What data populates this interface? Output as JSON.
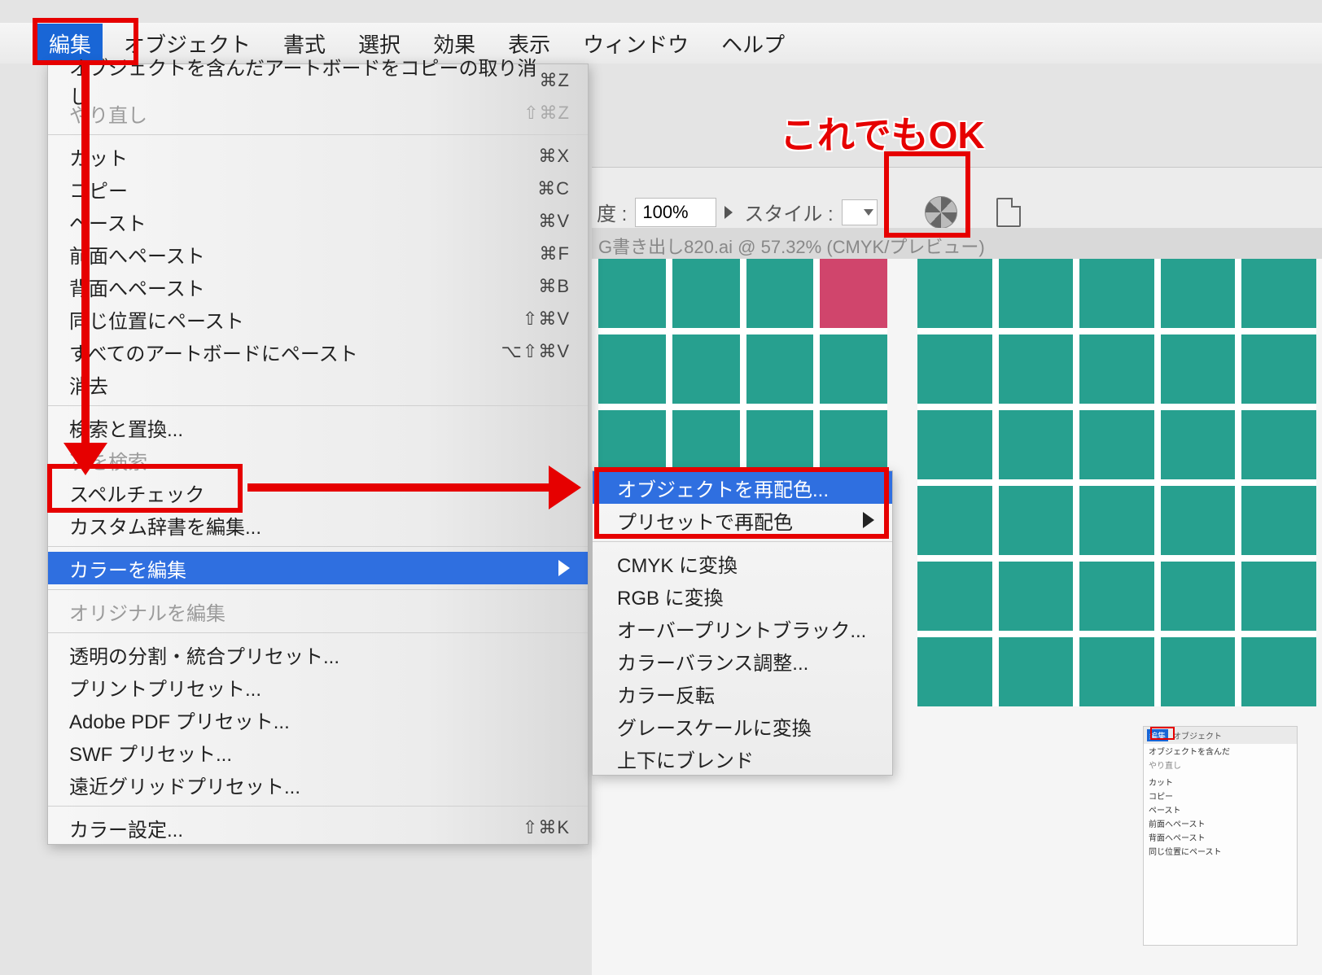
{
  "menubar": {
    "items": [
      "編集",
      "オブジェクト",
      "書式",
      "選択",
      "効果",
      "表示",
      "ウィンドウ",
      "ヘルプ"
    ]
  },
  "edit_menu": {
    "undo": {
      "label": "オブジェクトを含んだアートボードをコピーの取り消し",
      "sc": "⌘Z"
    },
    "redo": {
      "label": "やり直し",
      "sc": "⇧⌘Z"
    },
    "cut": {
      "label": "カット",
      "sc": "⌘X"
    },
    "copy": {
      "label": "コピー",
      "sc": "⌘C"
    },
    "paste": {
      "label": "ペースト",
      "sc": "⌘V"
    },
    "paste_front": {
      "label": "前面へペースト",
      "sc": "⌘F"
    },
    "paste_back": {
      "label": "背面へペースト",
      "sc": "⌘B"
    },
    "paste_place": {
      "label": "同じ位置にペースト",
      "sc": "⇧⌘V"
    },
    "paste_all": {
      "label": "すべてのアートボードにペースト",
      "sc": "⌥⇧⌘V"
    },
    "clear": {
      "label": "消去"
    },
    "find_replace": {
      "label": "検索と置換..."
    },
    "find_next": {
      "label": "次を検索"
    },
    "spell": {
      "label": "スペルチェック"
    },
    "custom_dict": {
      "label": "カスタム辞書を編集..."
    },
    "edit_colors": {
      "label": "カラーを編集"
    },
    "edit_original": {
      "label": "オリジナルを編集"
    },
    "trans_preset": {
      "label": "透明の分割・統合プリセット..."
    },
    "print_preset": {
      "label": "プリントプリセット..."
    },
    "pdf_preset": {
      "label": "Adobe PDF プリセット..."
    },
    "swf_preset": {
      "label": "SWF プリセット..."
    },
    "persp_preset": {
      "label": "遠近グリッドプリセット..."
    },
    "color_settings": {
      "label": "カラー設定...",
      "sc": "⇧⌘K"
    }
  },
  "color_submenu": {
    "recolor": "オブジェクトを再配色...",
    "recolor_preset": "プリセットで再配色",
    "to_cmyk": "CMYK に変換",
    "to_rgb": "RGB に変換",
    "overprint": "オーバープリントブラック...",
    "color_balance": "カラーバランス調整...",
    "invert": "カラー反転",
    "to_gray": "グレースケールに変換",
    "blend_v": "上下にブレンド"
  },
  "toolbar": {
    "opacity_label": "度 :",
    "opacity_value": "100%",
    "style_label": "スタイル :"
  },
  "tab": {
    "title": "G書き出し820.ai @ 57.32% (CMYK/プレビュー)"
  },
  "annotation": {
    "ok_text": "これでもOK"
  },
  "thumb": {
    "edit": "編集",
    "object": "オブジェクト",
    "rows": [
      "オブジェクトを含んだ",
      "やり直し",
      "カット",
      "コピー",
      "ペースト",
      "前面へペースト",
      "背面へペースト",
      "同じ位置にペースト"
    ]
  }
}
